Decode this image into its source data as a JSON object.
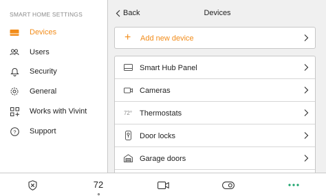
{
  "sidebar": {
    "heading": "SMART HOME SETTINGS",
    "items": [
      {
        "label": "Devices",
        "icon": "devices-icon",
        "active": true
      },
      {
        "label": "Users",
        "icon": "users-icon",
        "active": false
      },
      {
        "label": "Security",
        "icon": "bell-icon",
        "active": false
      },
      {
        "label": "General",
        "icon": "gear-icon",
        "active": false
      },
      {
        "label": "Works with Vivint",
        "icon": "grid-plus-icon",
        "active": false
      },
      {
        "label": "Support",
        "icon": "help-icon",
        "active": false
      }
    ]
  },
  "header": {
    "back_label": "Back",
    "title": "Devices"
  },
  "add_device": {
    "plus": "+",
    "label": "Add new device"
  },
  "device_list": [
    {
      "label": "Smart Hub Panel",
      "icon": "panel-icon"
    },
    {
      "label": "Cameras",
      "icon": "camera-icon"
    },
    {
      "label": "Thermostats",
      "icon": "thermostat-icon",
      "icon_text": "72°"
    },
    {
      "label": "Door locks",
      "icon": "lock-icon"
    },
    {
      "label": "Garage doors",
      "icon": "garage-icon"
    }
  ],
  "bottom_nav": {
    "security": "shield-icon",
    "temperature": "72",
    "camera": "video-camera-icon",
    "toggle": "toggle-icon",
    "more": "more-dots-icon"
  },
  "colors": {
    "accent": "#f28c1a",
    "more_dots": "#1aa36b"
  }
}
